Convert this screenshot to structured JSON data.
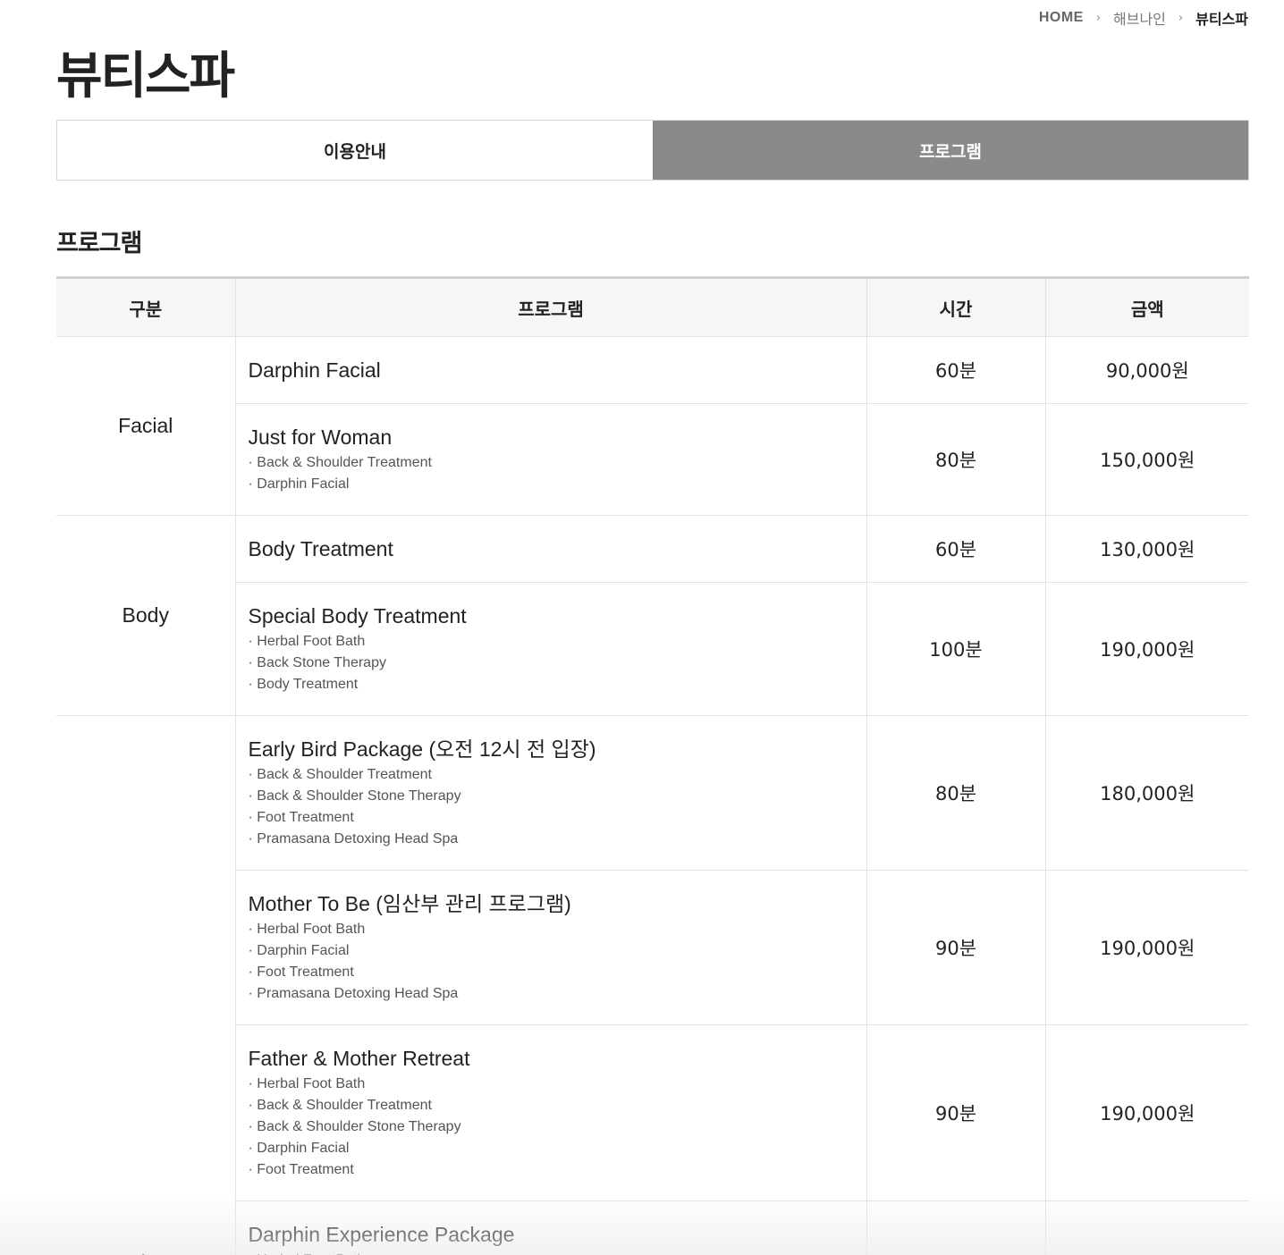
{
  "breadcrumb": {
    "home": "HOME",
    "parent": "해브나인",
    "current": "뷰티스파"
  },
  "page_title": "뷰티스파",
  "tabs": [
    {
      "label": "이용안내",
      "active": false
    },
    {
      "label": "프로그램",
      "active": true
    }
  ],
  "section_title": "프로그램",
  "table": {
    "headers": [
      "구분",
      "프로그램",
      "시간",
      "금액"
    ],
    "groups": [
      {
        "category": "Facial",
        "rows": [
          {
            "name": "Darphin Facial",
            "items": [],
            "time": "60분",
            "price": "90,000원"
          },
          {
            "name": "Just for Woman",
            "items": [
              "Back & Shoulder Treatment",
              "Darphin Facial"
            ],
            "time": "80분",
            "price": "150,000원"
          }
        ]
      },
      {
        "category": "Body",
        "rows": [
          {
            "name": "Body Treatment",
            "items": [],
            "time": "60분",
            "price": "130,000원"
          },
          {
            "name": "Special Body Treatment",
            "items": [
              "Herbal Foot Bath",
              "Back Stone Therapy",
              "Body Treatment"
            ],
            "time": "100분",
            "price": "190,000원"
          }
        ]
      },
      {
        "category": "Package",
        "rows": [
          {
            "name": "Early Bird Package (오전 12시 전 입장)",
            "items": [
              "Back & Shoulder Treatment",
              "Back & Shoulder Stone Therapy",
              "Foot Treatment",
              "Pramasana Detoxing Head Spa"
            ],
            "time": "80분",
            "price": "180,000원"
          },
          {
            "name": "Mother To Be (임산부 관리 프로그램)",
            "items": [
              "Herbal Foot Bath",
              "Darphin Facial",
              "Foot Treatment",
              "Pramasana Detoxing Head Spa"
            ],
            "time": "90분",
            "price": "190,000원"
          },
          {
            "name": "Father & Mother Retreat",
            "items": [
              "Herbal Foot Bath",
              "Back & Shoulder Treatment",
              "Back & Shoulder Stone Therapy",
              "Darphin Facial",
              "Foot Treatment"
            ],
            "time": "90분",
            "price": "190,000원"
          },
          {
            "name": "Darphin Experience Package",
            "items": [
              "Herbal Foot Bath"
            ],
            "time": "",
            "price": ""
          }
        ]
      }
    ]
  }
}
